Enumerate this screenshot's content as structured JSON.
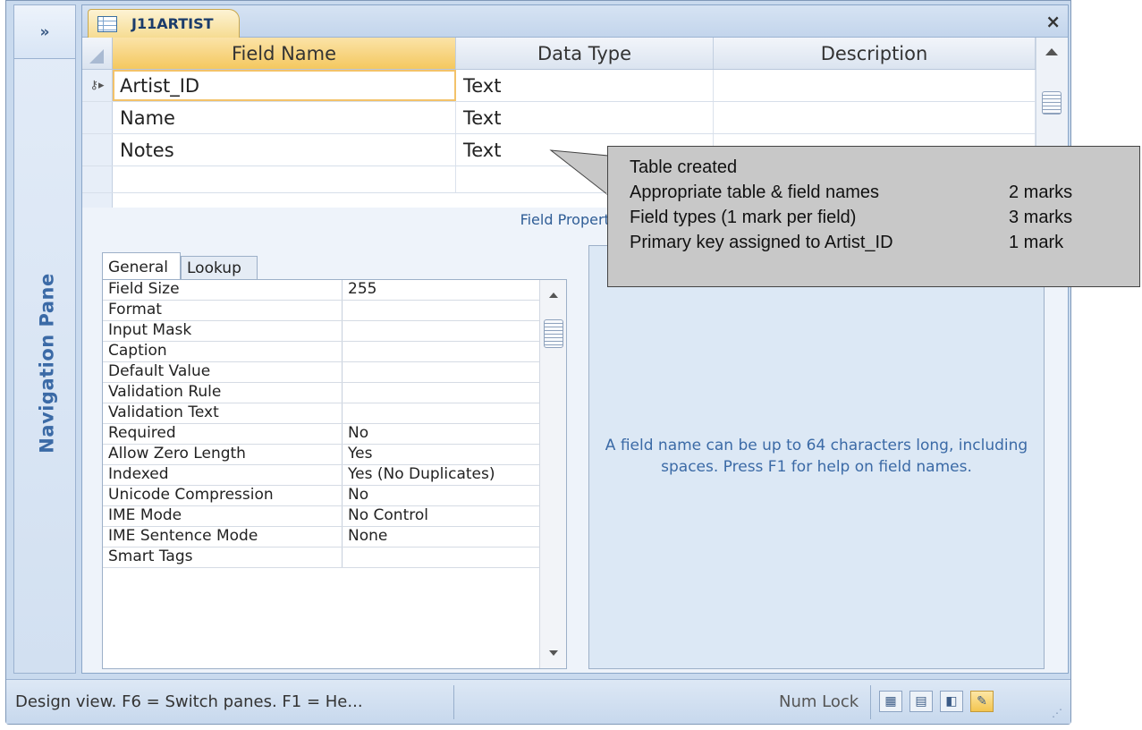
{
  "nav": {
    "toggle": "»",
    "label": "Navigation Pane"
  },
  "document": {
    "tab_label": "J11ARTIST",
    "close": "×"
  },
  "grid": {
    "headers": {
      "field": "Field Name",
      "type": "Data Type",
      "description": "Description"
    },
    "rows": [
      {
        "field": "Artist_ID",
        "type": "Text",
        "description": "",
        "primary_key": true,
        "selected": true
      },
      {
        "field": "Name",
        "type": "Text",
        "description": ""
      },
      {
        "field": "Notes",
        "type": "Text",
        "description": ""
      },
      {
        "field": "",
        "type": "",
        "description": ""
      }
    ],
    "key_marker": "⚷▸"
  },
  "properties": {
    "title": "Field Properties",
    "tabs": [
      "General",
      "Lookup"
    ],
    "rows": [
      {
        "name": "Field Size",
        "value": "255"
      },
      {
        "name": "Format",
        "value": ""
      },
      {
        "name": "Input Mask",
        "value": ""
      },
      {
        "name": "Caption",
        "value": ""
      },
      {
        "name": "Default Value",
        "value": ""
      },
      {
        "name": "Validation Rule",
        "value": ""
      },
      {
        "name": "Validation Text",
        "value": ""
      },
      {
        "name": "Required",
        "value": "No"
      },
      {
        "name": "Allow Zero Length",
        "value": "Yes"
      },
      {
        "name": "Indexed",
        "value": "Yes (No Duplicates)"
      },
      {
        "name": "Unicode Compression",
        "value": "No"
      },
      {
        "name": "IME Mode",
        "value": "No Control"
      },
      {
        "name": "IME Sentence Mode",
        "value": "None"
      },
      {
        "name": "Smart Tags",
        "value": ""
      }
    ],
    "help": "A field name can be up to 64 characters long, including spaces.  Press F1 for help on field names."
  },
  "status": {
    "text": "Design view.  F6 = Switch panes.  F1 = He...",
    "numlock": "Num Lock"
  },
  "callout": {
    "title": "Table created",
    "items": [
      {
        "label": "Appropriate table & field names",
        "marks": "2 marks"
      },
      {
        "label": "Field types (1 mark per field)",
        "marks": "3 marks"
      },
      {
        "label": "Primary key assigned to Artist_ID",
        "marks": "1 mark"
      }
    ]
  },
  "colors": {
    "accent": "#f4c85f",
    "pane_bg": "#c9daee",
    "help_text": "#3b6aa6"
  }
}
